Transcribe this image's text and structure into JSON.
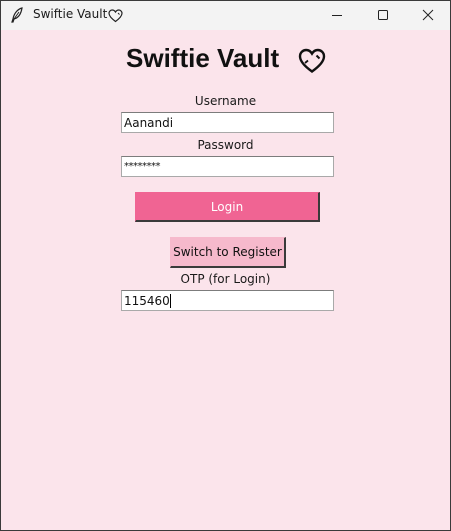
{
  "window": {
    "title": "Swiftie Vault",
    "title_icon": "heart-outline-icon",
    "app_icon": "feather-icon",
    "controls": [
      "minimize-icon",
      "maximize-icon",
      "close-icon"
    ]
  },
  "app": {
    "heading": "Swiftie Vault",
    "heading_icon": "heart-outline-icon"
  },
  "form": {
    "username_label": "Username",
    "username_value": "Aanandi",
    "password_label": "Password",
    "password_value": "********",
    "login_button": "Login",
    "switch_button": "Switch to Register",
    "otp_label": "OTP (for Login)",
    "otp_value": "115460"
  },
  "colors": {
    "background": "#fbe4eb",
    "login_button": "#f06493",
    "switch_button": "#f6b9cc",
    "titlebar": "#f3f3f3"
  }
}
